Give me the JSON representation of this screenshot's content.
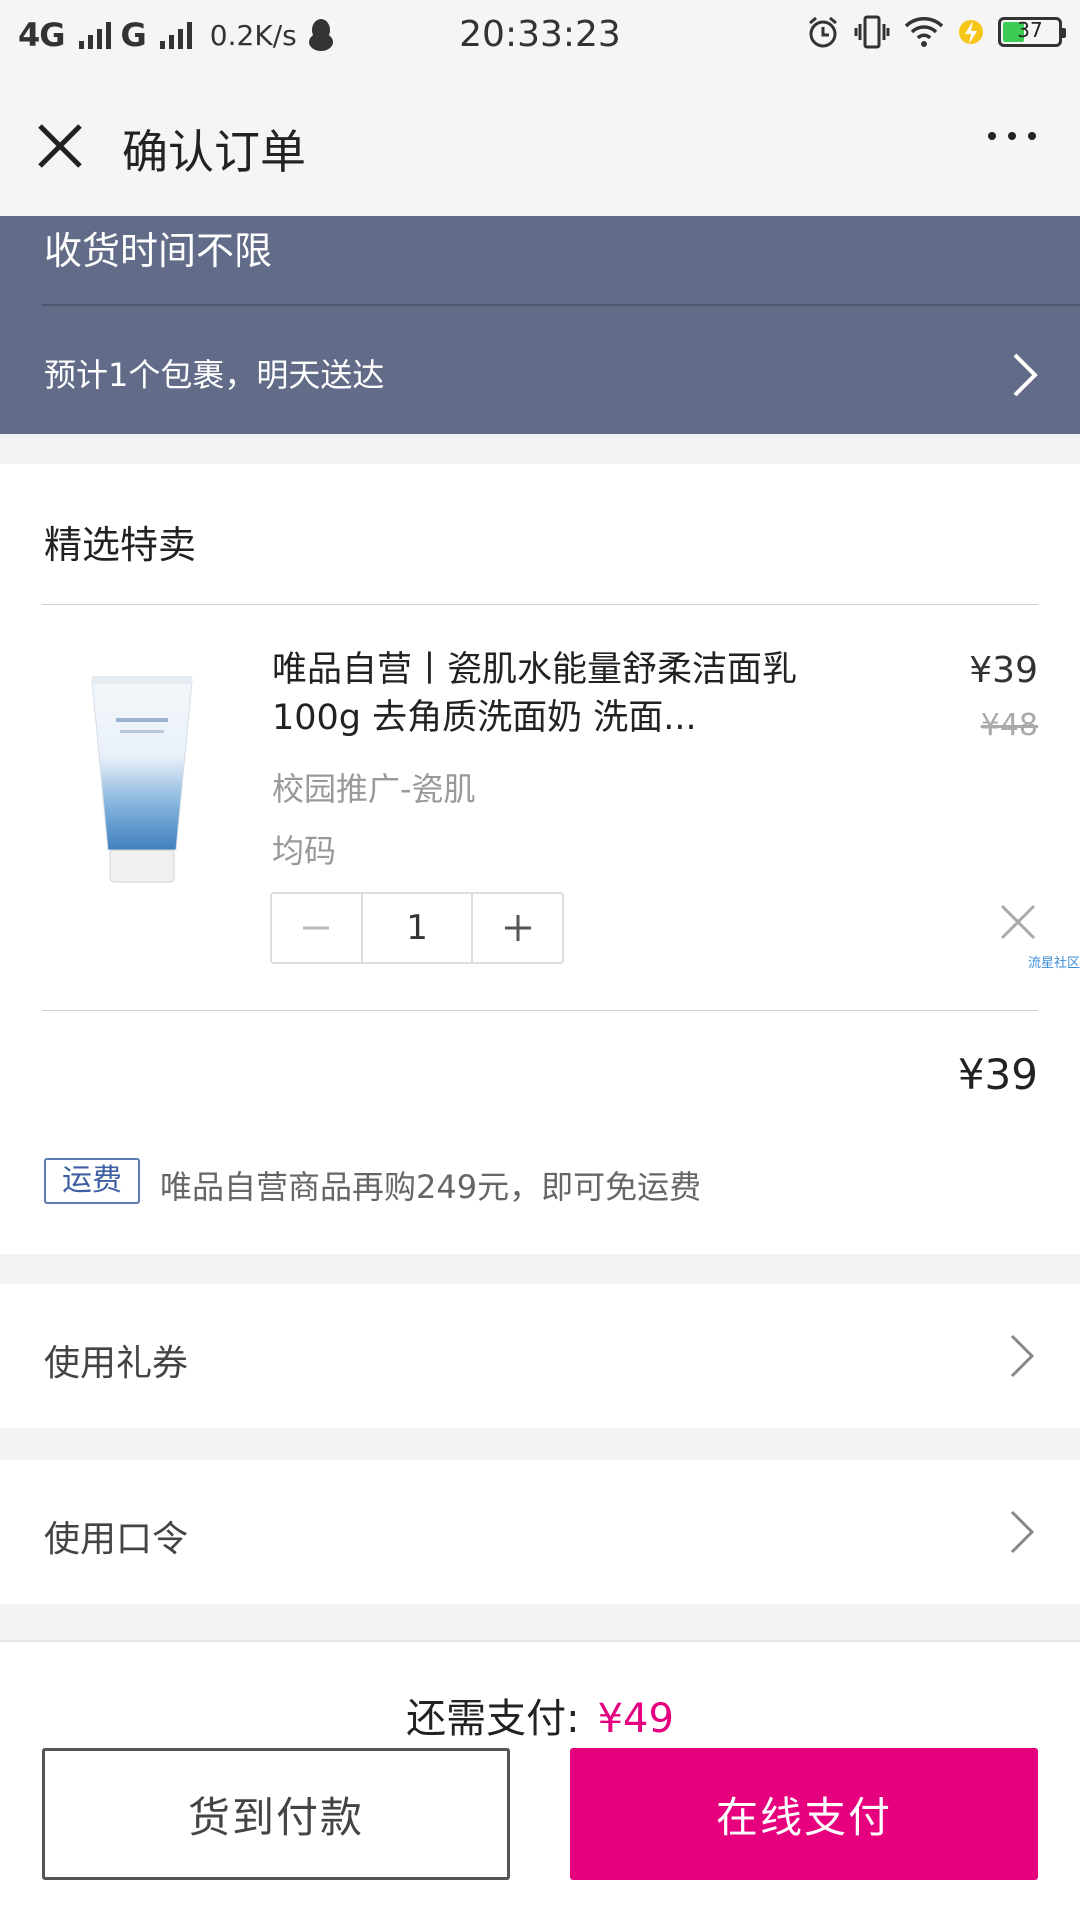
{
  "status_bar": {
    "network1": "4G",
    "network2": "G",
    "speed": "0.2K/s",
    "time": "20:33:23",
    "battery": "37"
  },
  "header": {
    "title": "确认订单"
  },
  "delivery": {
    "time_note": "收货时间不限",
    "package_note": "预计1个包裹，明天送达"
  },
  "goods": {
    "section_title": "精选特卖",
    "product": {
      "name": "唯品自营丨瓷肌水能量舒柔洁面乳100g 去角质洗面奶 洗面...",
      "price": "¥39",
      "original_price": "¥48",
      "tag": "校园推广-瓷肌",
      "size": "均码",
      "quantity": "1"
    },
    "watermark": "流星社区",
    "subtotal": "¥39",
    "shipping_badge": "运费",
    "shipping_note": "唯品自营商品再购249元，即可免运费"
  },
  "options": {
    "coupon": "使用礼券",
    "code": "使用口令"
  },
  "footer": {
    "pay_label": "还需支付:",
    "pay_amount": "¥49",
    "cod_button": "货到付款",
    "online_button": "在线支付"
  },
  "colors": {
    "delivery_bg": "#626b87",
    "accent": "#e6007e",
    "battery": "#3ccb55"
  }
}
